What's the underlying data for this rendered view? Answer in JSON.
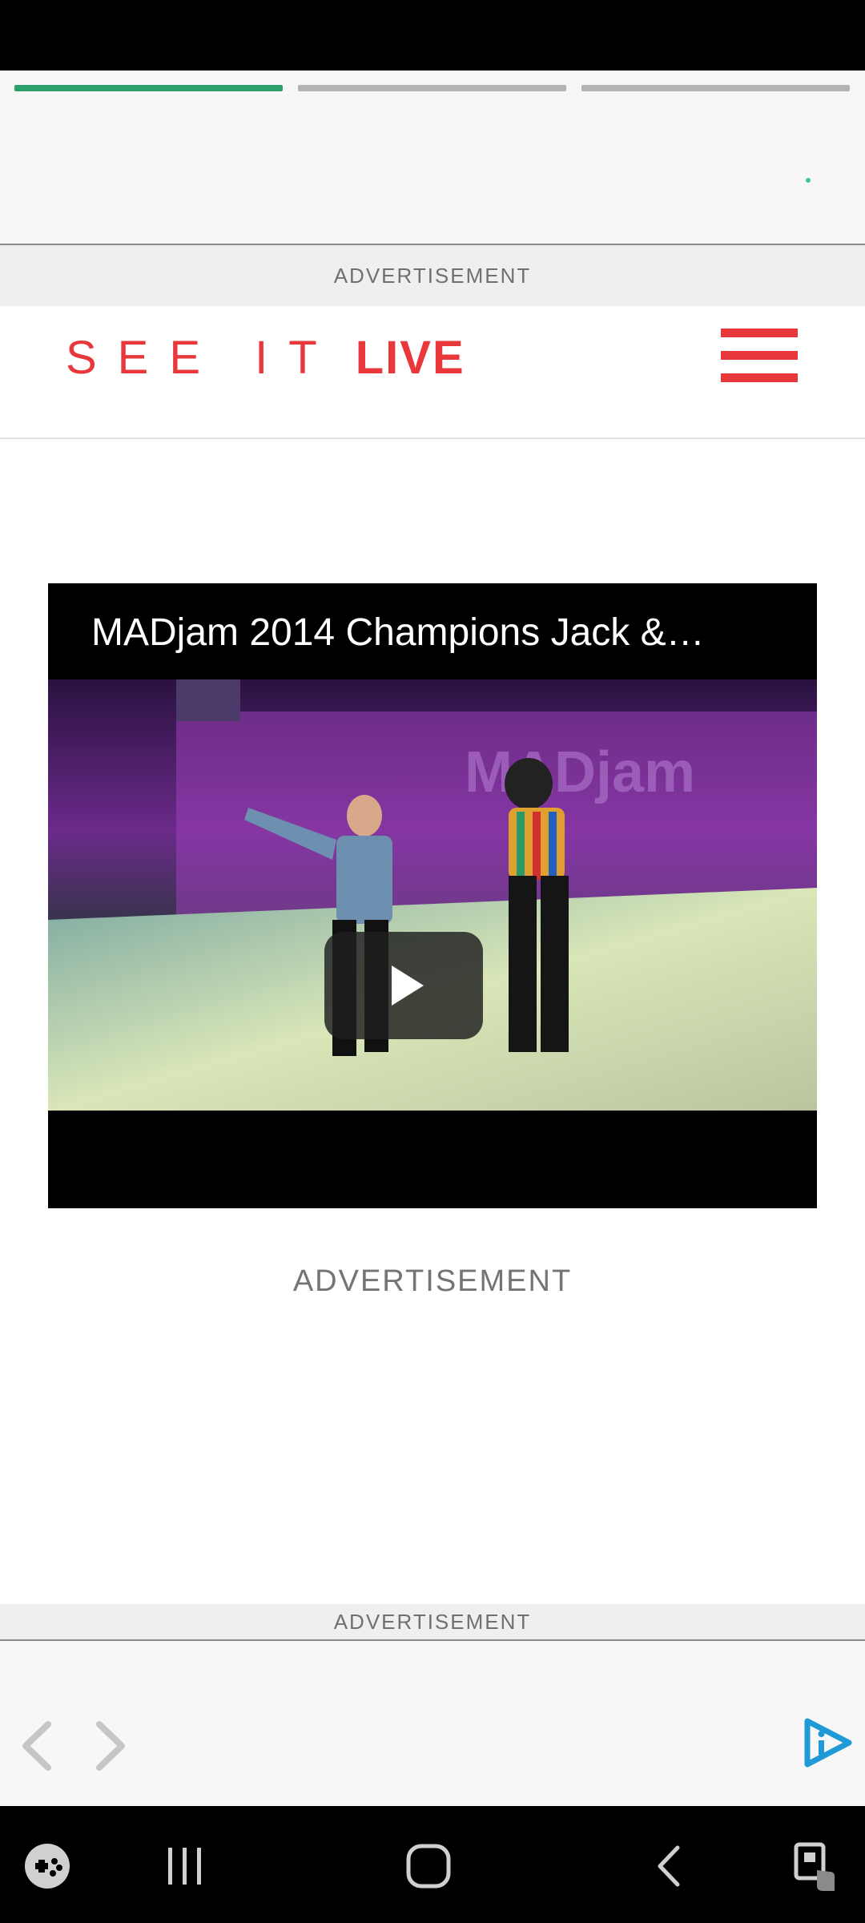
{
  "story": {
    "progress": [
      {
        "state": "active"
      },
      {
        "state": "inactive"
      },
      {
        "state": "inactive"
      }
    ]
  },
  "ads": {
    "top_label": "ADVERTISEMENT",
    "middle_label": "ADVERTISEMENT",
    "bottom_label": "ADVERTISEMENT"
  },
  "header": {
    "logo_see": "SEE IT",
    "logo_live": "LIVE",
    "menu_icon": "hamburger-icon"
  },
  "video": {
    "title": "MADjam 2014 Champions Jack &…",
    "play_icon": "play-icon"
  },
  "footer": {
    "prev_icon": "chevron-left-icon",
    "next_icon": "chevron-right-icon",
    "brand_icon": "play-info-icon"
  },
  "system_nav": {
    "buttons": [
      "game-launcher-icon",
      "recent-apps-icon",
      "home-icon",
      "back-icon",
      "accessibility-icon"
    ]
  },
  "colors": {
    "brand_red": "#e8383b",
    "progress_active": "#2aa06b",
    "progress_inactive": "#b3b3b3",
    "brand_blue": "#1f9ad6"
  }
}
